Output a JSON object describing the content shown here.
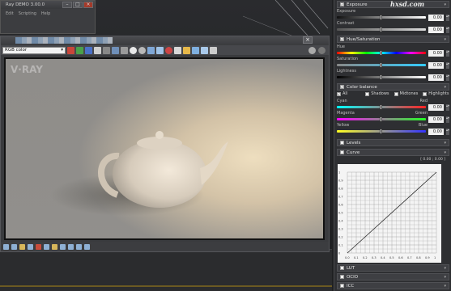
{
  "max_window": {
    "title": "Ray DEMO 3.00.0",
    "menu": [
      "Edit",
      "Scripting",
      "Help"
    ]
  },
  "vfb": {
    "channel": "RGB color",
    "close_glyph": "×",
    "logo_text": "V·RAY"
  },
  "panel": {
    "watermark": "hxsd.com",
    "exposure": {
      "header": "Exposure",
      "exposure_label": "Exposure",
      "exposure_value": "0.00",
      "contrast_label": "Contrast",
      "contrast_value": "0.00"
    },
    "hue_sat": {
      "header": "Hue/Saturation",
      "hue_label": "Hue",
      "hue_value": "0.00",
      "saturation_label": "Saturation",
      "saturation_value": "0.00",
      "lightness_label": "Lightness",
      "lightness_value": "0.00"
    },
    "color_balance": {
      "header": "Color balance",
      "modes": [
        "All",
        "Shadows",
        "Midtones",
        "Highlights"
      ],
      "cyan_red": {
        "left": "Cyan",
        "right": "Red",
        "value": "0.00"
      },
      "magenta_green": {
        "left": "Magenta",
        "right": "Green",
        "value": "0.00"
      },
      "yellow_blue": {
        "left": "Yellow",
        "right": "Blue",
        "value": "0.00"
      }
    },
    "levels_header": "Levels",
    "curve": {
      "header": "Curve",
      "readout": "[ 0.00 ; 0.00 ]",
      "y_ticks": [
        "1",
        "0.9",
        "0.8",
        "0.7",
        "0.6",
        "0.5",
        "0.4",
        "0.3",
        "0.2",
        "0.1",
        "0"
      ],
      "x_ticks": [
        "0.0",
        "0.1",
        "0.2",
        "0.3",
        "0.4",
        "0.5",
        "0.6",
        "0.7",
        "0.8",
        "0.9",
        "1"
      ]
    },
    "lut_header": "LUT",
    "ocio_header": "OCIO",
    "icc_header": "ICC"
  },
  "colors": {
    "panel_bg": "#2e2f32",
    "section_header": "#3e3f43",
    "render_light": "#f1dcb3",
    "render_shadow": "#6f6d6b",
    "timeline_rail": "#6b5a22"
  }
}
